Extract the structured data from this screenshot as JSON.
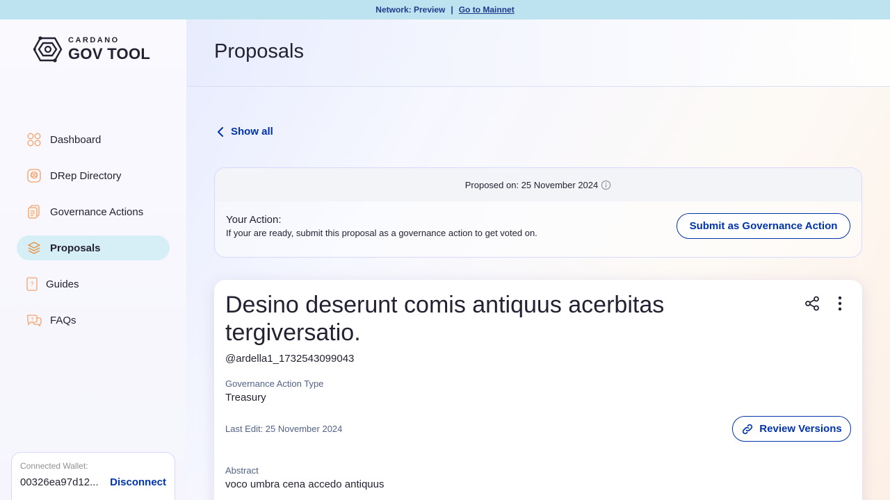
{
  "banner": {
    "network": "Network: Preview",
    "separator": "|",
    "link": "Go to Mainnet"
  },
  "logo": {
    "small": "CARDANO",
    "big": "GOV TOOL"
  },
  "nav": {
    "items": [
      {
        "label": "Dashboard",
        "icon": "dashboard-icon"
      },
      {
        "label": "DRep Directory",
        "icon": "drep-directory-icon"
      },
      {
        "label": "Governance Actions",
        "icon": "governance-actions-icon"
      },
      {
        "label": "Proposals",
        "icon": "proposals-icon",
        "active": true
      },
      {
        "label": "Guides",
        "icon": "guides-icon"
      },
      {
        "label": "FAQs",
        "icon": "faqs-icon"
      }
    ]
  },
  "wallet": {
    "label": "Connected Wallet:",
    "address": "00326ea97d12...",
    "disconnect": "Disconnect"
  },
  "header": {
    "title": "Proposals"
  },
  "back": {
    "label": "Show all"
  },
  "action_card": {
    "proposed_on": "Proposed on: 25 November 2024",
    "title": "Your Action:",
    "description": "If your are ready, submit this proposal as a governance action to get voted on.",
    "submit_label": "Submit as Governance Action"
  },
  "proposal": {
    "title": "Desino deserunt comis antiquus acerbitas tergiversatio.",
    "author": "@ardella1_1732543099043",
    "type_label": "Governance Action Type",
    "type_value": "Treasury",
    "last_edit": "Last Edit: 25 November 2024",
    "review_label": "Review Versions",
    "abstract_label": "Abstract",
    "abstract_value": "voco umbra cena accedo antiquus"
  },
  "colors": {
    "accent": "#0033ad",
    "active_nav": "#d6eff6",
    "banner": "#bde3f1",
    "icon_orange": "#f2a269"
  }
}
